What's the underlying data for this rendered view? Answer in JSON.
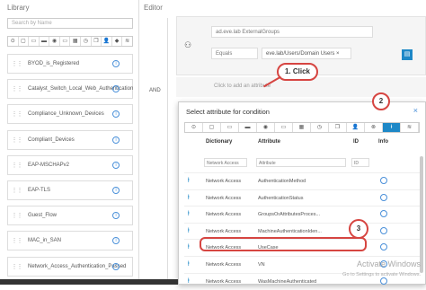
{
  "library": {
    "title": "Library",
    "search_placeholder": "Search by Name",
    "icons": [
      "location-icon",
      "square-icon",
      "monitor-icon",
      "toggle-icon",
      "badge-icon",
      "wifi-icon",
      "calendar-icon",
      "clock-icon",
      "copy-icon",
      "user-icon",
      "shield-icon",
      "network-icon"
    ],
    "icon_glyphs": [
      "⊙",
      "▢",
      "▭",
      "▬",
      "◉",
      "▭",
      "▦",
      "◷",
      "❐",
      "👤",
      "◆",
      "≋"
    ],
    "items": [
      {
        "label": "BYOD_is_Registered"
      },
      {
        "label": "Catalyst_Switch_Local_Web_Authentication"
      },
      {
        "label": "Compliance_Unknown_Devices"
      },
      {
        "label": "Compliant_Devices"
      },
      {
        "label": "EAP-MSCHAPv2"
      },
      {
        "label": "EAP-TLS"
      },
      {
        "label": "Guest_Flow"
      },
      {
        "label": "MAC_in_SAN"
      },
      {
        "label": "Network_Access_Authentication_Passed"
      }
    ]
  },
  "editor": {
    "title": "Editor",
    "group_value": "ad.eve.lab ExternalGroups",
    "operator": "Equals",
    "chip": "eve.lab/Users/Domain Users ×",
    "and_label": "AND",
    "attr_placeholder": "Click to add an attribute"
  },
  "popup": {
    "title": "Select attribute for condition",
    "close": "×",
    "icon_glyphs": [
      "⊙",
      "▢",
      "▭",
      "▬",
      "◉",
      "▭",
      "▦",
      "◷",
      "❐",
      "👤",
      "⊗",
      "ⱡ",
      "≋"
    ],
    "headers": {
      "dictionary": "Dictionary",
      "attribute": "Attribute",
      "id": "ID",
      "info": "Info"
    },
    "filter": {
      "dictionary": "Network Access",
      "attribute": "Attribute",
      "id": "ID"
    },
    "rows": [
      {
        "dictionary": "Network Access",
        "attribute": "AuthenticationMethod"
      },
      {
        "dictionary": "Network Access",
        "attribute": "AuthenticationStatus"
      },
      {
        "dictionary": "Network Access",
        "attribute": "GroupsOrAttributesProces..."
      },
      {
        "dictionary": "Network Access",
        "attribute": "MachineAuthenticationIden..."
      },
      {
        "dictionary": "Network Access",
        "attribute": "UseCase"
      },
      {
        "dictionary": "Network Access",
        "attribute": "VN"
      },
      {
        "dictionary": "Network Access",
        "attribute": "WasMachineAuthenticated"
      }
    ]
  },
  "callouts": {
    "one": "1. Click",
    "two": "2",
    "three": "3"
  },
  "watermark": {
    "title": "Activate Windows",
    "sub": "Go to Settings to activate Windows."
  },
  "colors": {
    "accent": "#1e88c7",
    "callout": "#d64541"
  }
}
